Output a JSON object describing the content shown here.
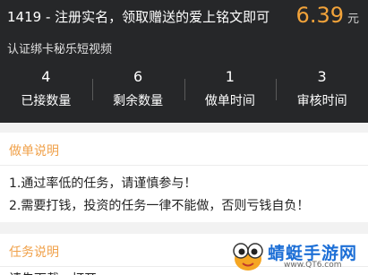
{
  "task": {
    "title": "1419 - 注册实名，领取赠送的爱上铭文即可",
    "price": "6.39",
    "price_unit": "元",
    "subtitle": "认证绑卡秘乐短视频"
  },
  "stats": [
    {
      "value": "4",
      "label": "已接数量"
    },
    {
      "value": "6",
      "label": "剩余数量"
    },
    {
      "value": "1",
      "label": "做单时间"
    },
    {
      "value": "3",
      "label": "审核时间"
    }
  ],
  "instructions": {
    "title": "做单说明",
    "lines": [
      "1.通过率低的任务，请谨慎参与！",
      "2.需要打钱，投资的任务一律不能做，否则亏钱自负！"
    ]
  },
  "task_desc": {
    "title": "任务说明",
    "partial_text": "请先下载，打开"
  },
  "watermark": {
    "name": "蜻蜓手游网",
    "url": "www.QT6.com",
    "colors": {
      "brand": "#1d6fd6",
      "accent": "#f5a623"
    }
  }
}
